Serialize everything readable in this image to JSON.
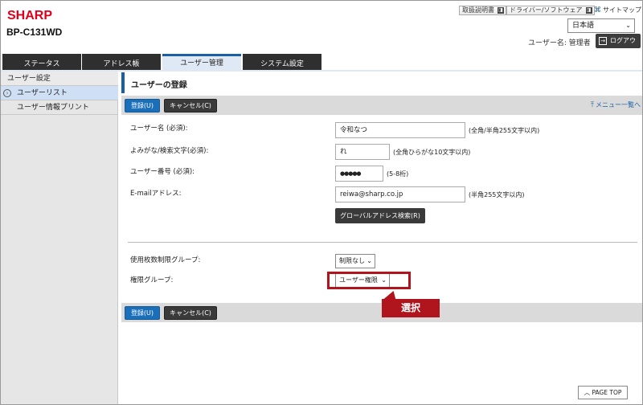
{
  "header": {
    "brand": "SHARP",
    "model": "BP-C131WD",
    "links": [
      "取扱説明書",
      "ドライバー/ソフトウェア"
    ],
    "sitemap": "サイトマップ",
    "language": "日本語",
    "username": "ユーザー名: 管理者",
    "logout": "ログアウト"
  },
  "tabs": [
    "ステータス",
    "アドレス帳",
    "ユーザー管理",
    "システム設定"
  ],
  "sidebar": {
    "title": "ユーザー設定",
    "items": [
      "ユーザーリスト",
      "ユーザー情報プリント"
    ]
  },
  "page": {
    "title": "ユーザーの登録",
    "register": "登録(U)",
    "cancel": "キャンセル(C)",
    "back": "メニュー一覧へ"
  },
  "form": {
    "name_label": "ユーザー名 (必須):",
    "name_value": "令和なつ",
    "name_hint": "(全角/半角255文字以内)",
    "kana_label": "よみがな/検索文字(必須):",
    "kana_value": "れ",
    "kana_hint": "(全角ひらがな10文字以内)",
    "number_label": "ユーザー番号 (必須):",
    "number_value": "●●●●●",
    "number_hint": "(5-8桁)",
    "email_label": "E-mailアドレス:",
    "email_value": "reiwa@sharp.co.jp",
    "email_hint": "(半角255文字以内)",
    "global_search": "グローバルアドレス検索(R)",
    "limit_label": "使用枚数制限グループ:",
    "limit_value": "制限なし",
    "authority_label": "権限グループ:",
    "authority_value": "ユーザー権限"
  },
  "callout": "選択",
  "page_top": "PAGE TOP"
}
